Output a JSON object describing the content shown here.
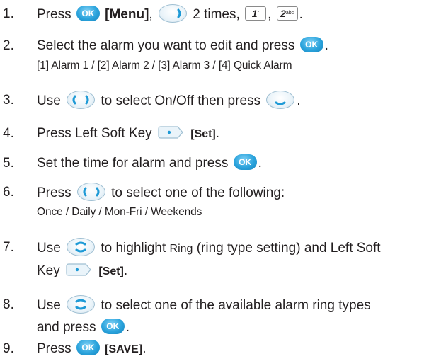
{
  "icons": {
    "ok_label": "OK",
    "key1_label": "1",
    "key2_label": "2",
    "key2_sub": "abc",
    "nav_icon": "navigation-key-icon",
    "soft_icon": "left-soft-key-icon"
  },
  "steps": [
    {
      "num": "1.",
      "pre": "Press",
      "menu": "[Menu]",
      "mid": "2 times,",
      "sep": ",",
      "end": "."
    },
    {
      "num": "2.",
      "text": "Select the alarm you want to edit and press",
      "end": ".",
      "sub": "[1] Alarm 1 / [2] Alarm 2 / [3] Alarm 3 / [4] Quick Alarm"
    },
    {
      "num": "3.",
      "pre": "Use",
      "mid": "to select On/Off then press",
      "end": "."
    },
    {
      "num": "4.",
      "pre": "Press Left Soft Key",
      "set": "[Set]",
      "end": "."
    },
    {
      "num": "5.",
      "text": "Set the time for alarm and press",
      "end": "."
    },
    {
      "num": "6.",
      "pre": "Press",
      "mid": "to select one of the following:",
      "sub": "Once / Daily / Mon-Fri / Weekends"
    },
    {
      "num": "7.",
      "pre": "Use",
      "mid": "to highlight",
      "ring": "Ring",
      "paren": "(ring type setting)",
      "post": "and Left Soft",
      "line2_pre": "Key",
      "set": "[Set]",
      "end": "."
    },
    {
      "num": "8.",
      "pre": "Use",
      "mid": "to select one of the available alarm ring types",
      "line2": "and press",
      "end": "."
    },
    {
      "num": "9.",
      "pre": "Press",
      "save": "[SAVE]",
      "end": "."
    }
  ]
}
